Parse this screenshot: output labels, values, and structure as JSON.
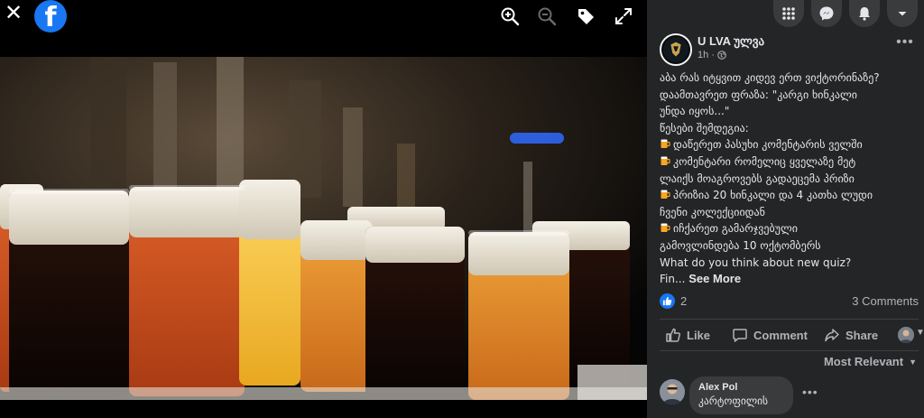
{
  "viewer": {
    "logo_letter": "f",
    "icons": {
      "close": "close-icon",
      "zoom_in": "zoom-in-icon",
      "zoom_out": "zoom-out-icon",
      "tag": "tag-icon",
      "fullscreen": "fullscreen-icon"
    },
    "close_glyph": "✕"
  },
  "topnav": {
    "items": [
      "menu-grid-icon",
      "messenger-icon",
      "notifications-icon",
      "account-caret-icon"
    ]
  },
  "post": {
    "author": "U LVA ულვა",
    "time": "1h ·",
    "text_lines": [
      "აბა რას იტყვით კიდევ ერთ ვიქტორინაზე?",
      "დაამთავრეთ ფრაზა: \"კარგი ხინკალი",
      "უნდა იყოს...\"",
      "წესები შემდეგია:",
      "დაწერეთ პასუხი კომენტარის ველში",
      "კომენტარი რომელიც ყველაზე მეტ",
      "ლაიქს მოაგროვებს გადაეცემა პრიზი",
      "პრიზია 20 ხინკალი და 4 კათხა ლუდი",
      "ჩვენი კოლექციიდან",
      "იჩქარეთ გამარჯვებული",
      "გამოვლინდება 10 ოქტომბერს",
      "What do you think about new quiz?"
    ],
    "emoji_lines": [
      4,
      5,
      7,
      9
    ],
    "truncated_prefix": "Fin...",
    "see_more": "See More",
    "reaction_count": "2",
    "comments_count": "3 Comments",
    "actions": {
      "like": "Like",
      "comment": "Comment",
      "share": "Share"
    },
    "sort_label": "Most Relevant",
    "colors": {
      "panel_bg": "#242526",
      "accent": "#1877f2",
      "text": "#e4e6eb",
      "muted": "#b0b3b8"
    }
  },
  "comments": [
    {
      "name": "Alex Pol",
      "text": "კარტოფილის"
    }
  ]
}
